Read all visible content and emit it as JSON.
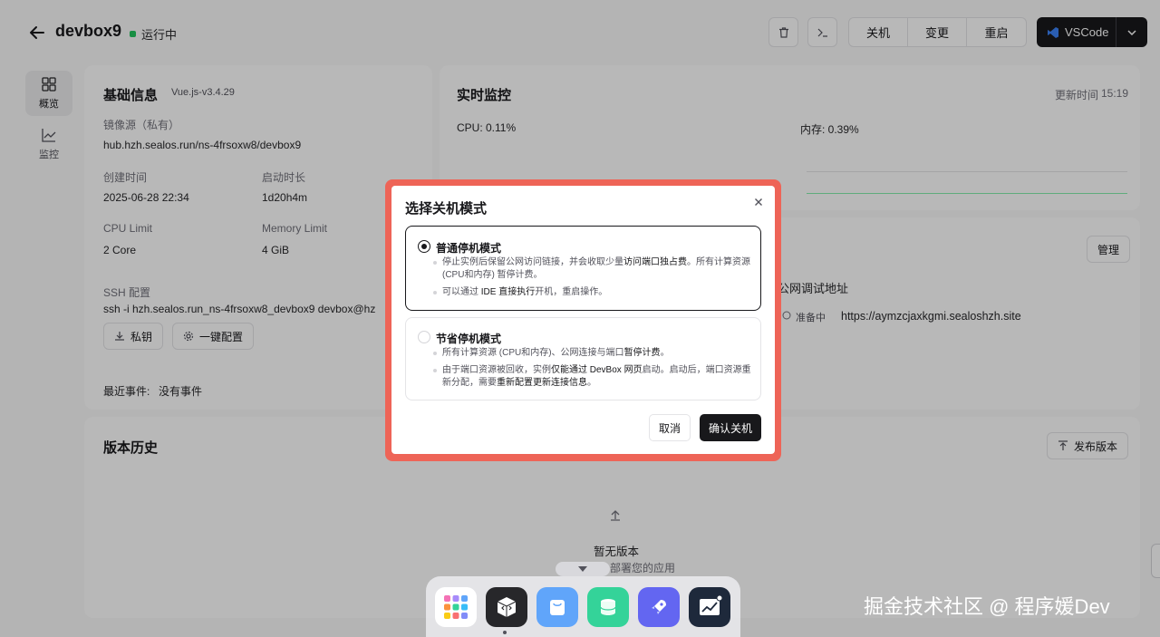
{
  "header": {
    "title": "devbox9",
    "status": "运行中",
    "actions": {
      "shutdown": "关机",
      "change": "变更",
      "restart": "重启"
    },
    "vscode_label": "VSCode"
  },
  "sidenav": {
    "overview": "概览",
    "monitor": "监控"
  },
  "basic": {
    "title": "基础信息",
    "version": "Vue.js-v3.4.29",
    "image_label": "镜像源（私有）",
    "image_value": "hub.hzh.sealos.run/ns-4frsoxw8/devbox9",
    "created_label": "创建时间",
    "created_value": "2025-06-28 22:34",
    "uptime_label": "启动时长",
    "uptime_value": "1d20h4m",
    "cpu_label": "CPU Limit",
    "cpu_value": "2 Core",
    "mem_label": "Memory Limit",
    "mem_value": "4 GiB",
    "ssh_label": "SSH 配置",
    "ssh_value": "ssh -i hzh.sealos.run_ns-4frsoxw8_devbox9 devbox@hz",
    "private_key_btn": "私钥",
    "one_click_btn": "一键配置",
    "recent_label": "最近事件:",
    "recent_value": "没有事件"
  },
  "monitor": {
    "title": "实时监控",
    "updated_label": "更新时间",
    "updated_value": "15:19",
    "cpu": "CPU: 0.11%",
    "mem": "内存: 0.39%"
  },
  "network": {
    "manage_btn": "管理",
    "col_public": "公网调试地址",
    "status": "准备中",
    "url": "https://aymzcjaxkgmi.sealoshzh.site"
  },
  "history": {
    "title": "版本历史",
    "publish_btn": "发布版本",
    "empty_title": "暂无版本",
    "empty_sub": "部署您的应用"
  },
  "modal": {
    "title": "选择关机模式",
    "option1": {
      "title": "普通停机模式",
      "b1_pre": "停止实例后保留公网访问链接，并会收取少量",
      "b1_em": "访问端口独占费",
      "b1_post": "。所有计算资源 (CPU和内存) 暂停计费。",
      "b2_pre": "可以通过 ",
      "b2_em": "IDE 直接执行",
      "b2_post": "开机，重启操作。"
    },
    "option2": {
      "title": "节省停机模式",
      "b1_pre": "所有计算资源 (CPU和内存)、公网连接与端口",
      "b1_em": "暂停计费",
      "b1_post": "。",
      "b2_pre": "由于端口资源被回收，实例",
      "b2_em": "仅能通过 DevBox 网页",
      "b2_mid": "启动。启动后，端口资源重新分配，需要",
      "b2_em2": "重新配置更新连接信息",
      "b2_post": "。"
    },
    "cancel": "取消",
    "confirm": "确认关机"
  },
  "watermark": "掘金技术社区 @ 程序媛Dev",
  "colors": {
    "accent": "#18181b",
    "highlight": "#ee6457",
    "running": "#22c55e"
  }
}
